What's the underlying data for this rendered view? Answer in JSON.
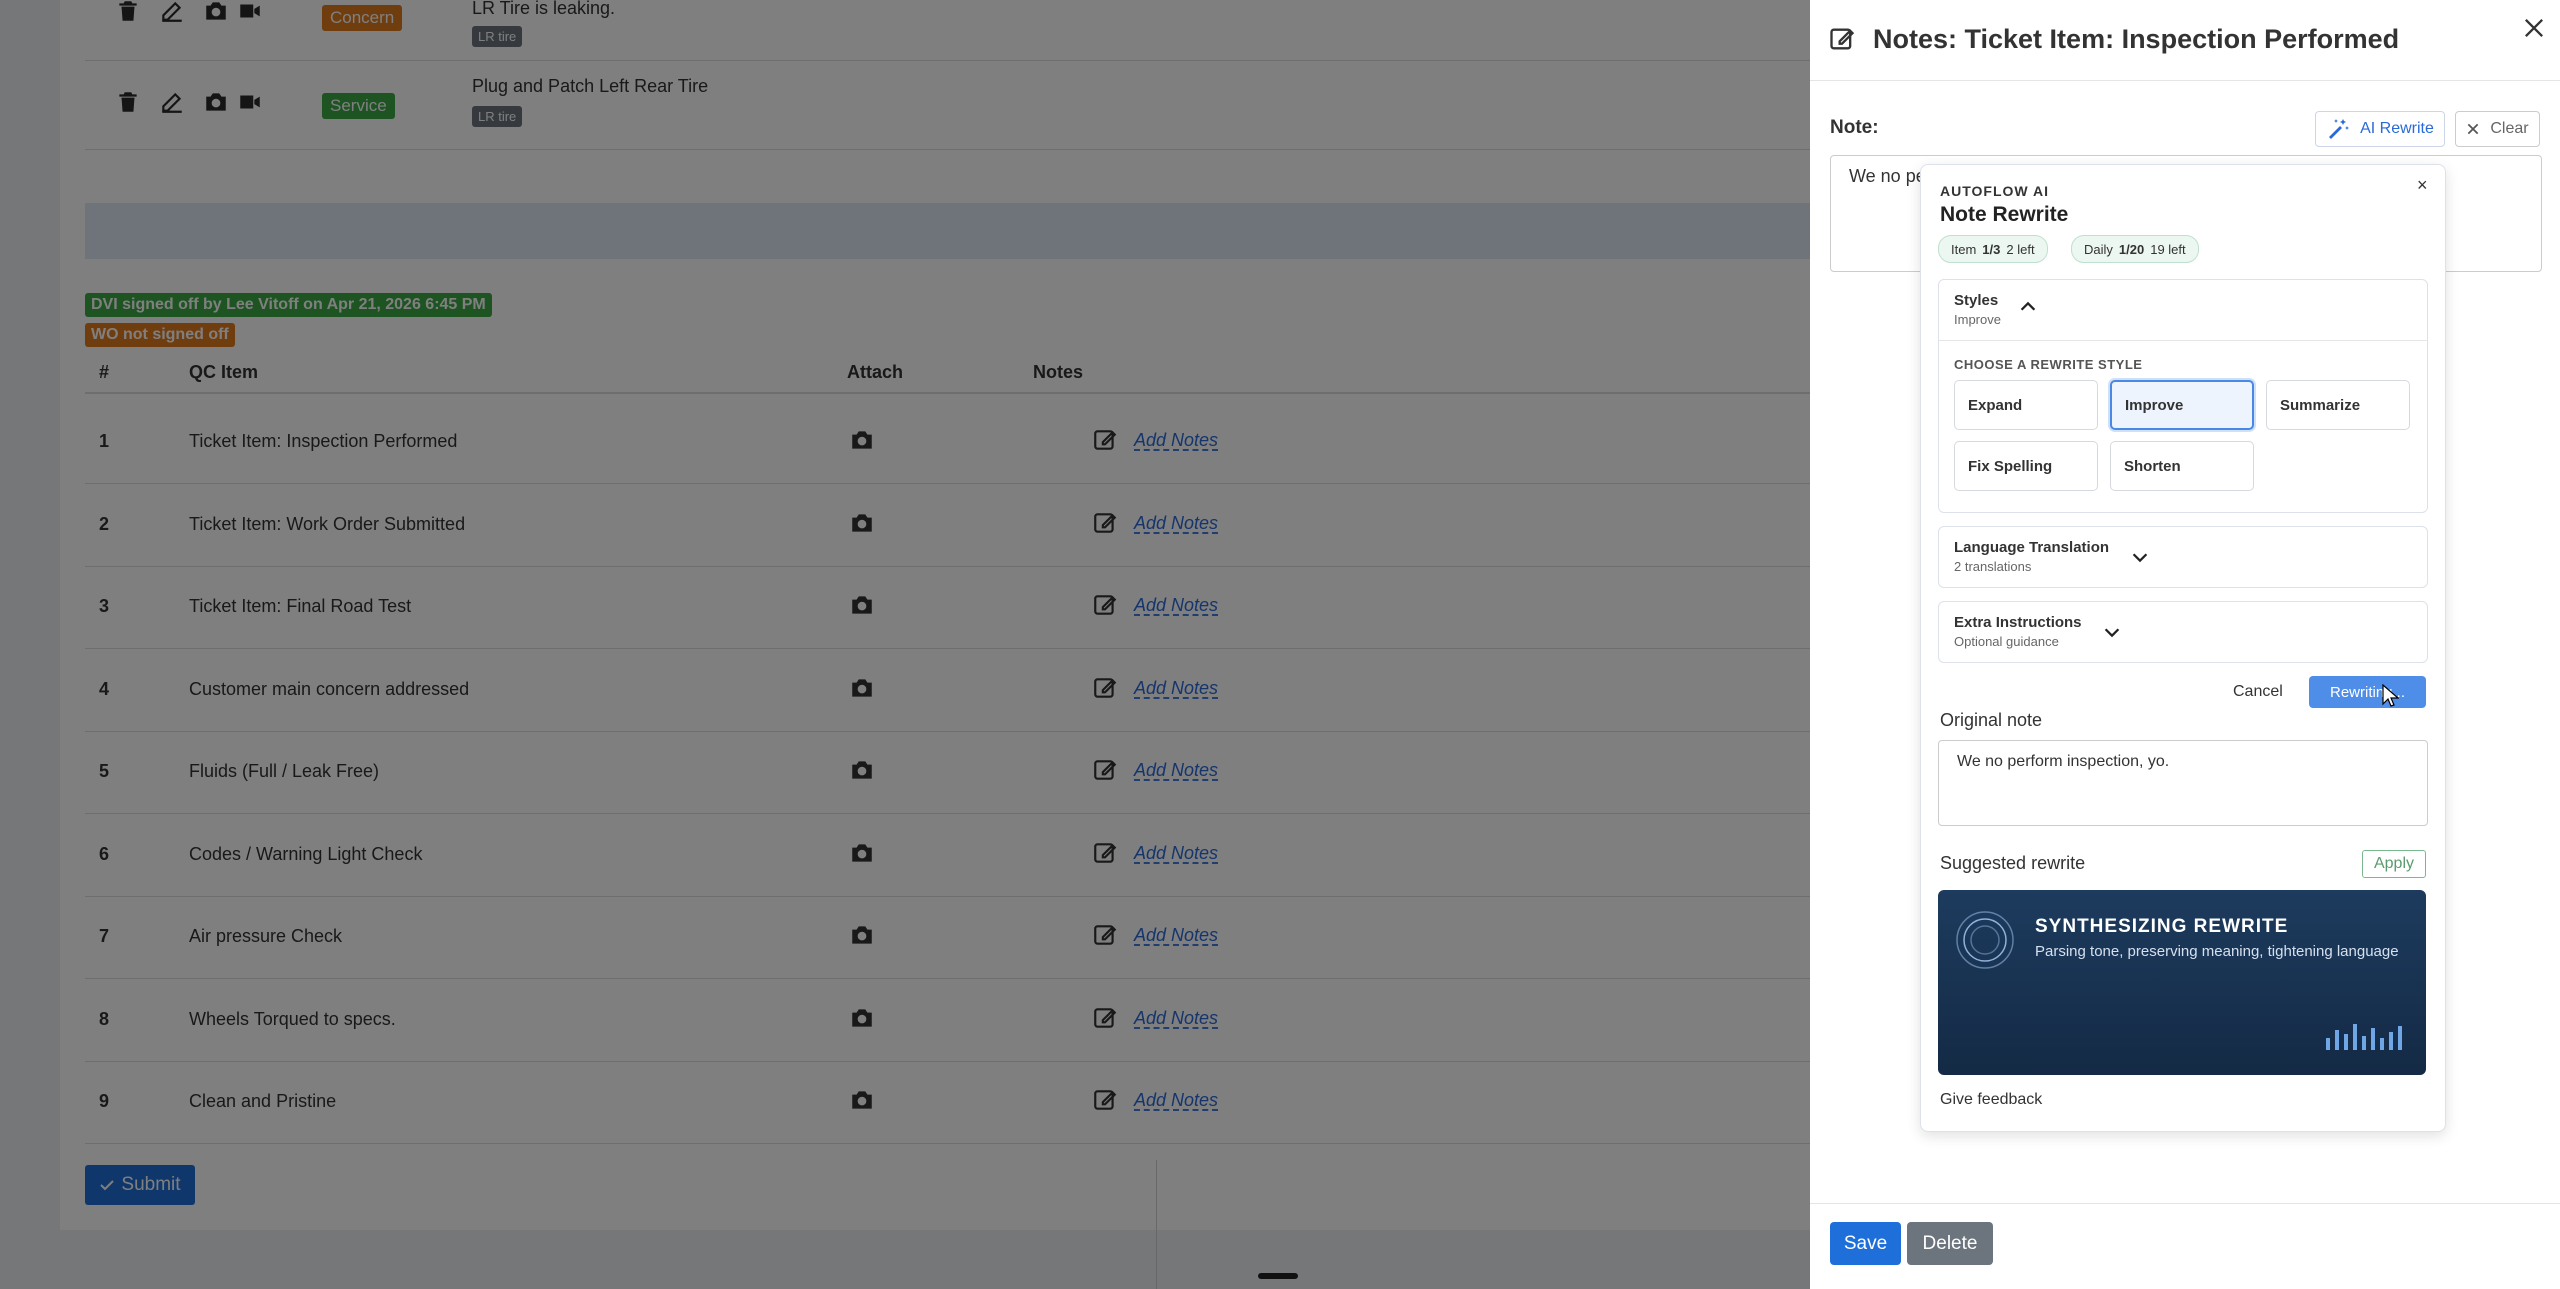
{
  "service_rows": [
    {
      "badge": "Concern",
      "badge_color": "#e07a1f",
      "text": "LR Tire is leaking.",
      "tag": "LR tire"
    },
    {
      "badge": "Service",
      "badge_color": "#3aa845",
      "text": "Plug and Patch Left Rear Tire",
      "tag": "LR tire"
    }
  ],
  "signoff": {
    "dvi": "DVI signed off by Lee Vitoff on Apr 21, 2026 6:45 PM",
    "dvi_color": "#3aa845",
    "wo": "WO not signed off",
    "wo_color": "#e07a1f"
  },
  "qc_table": {
    "headers": {
      "num": "#",
      "item": "QC Item",
      "attach": "Attach",
      "notes": "Notes"
    },
    "rows": [
      {
        "num": "1",
        "item": "Ticket Item: Inspection Performed",
        "notes_link": "Add Notes"
      },
      {
        "num": "2",
        "item": "Ticket Item: Work Order Submitted",
        "notes_link": "Add Notes"
      },
      {
        "num": "3",
        "item": "Ticket Item: Final Road Test",
        "notes_link": "Add Notes"
      },
      {
        "num": "4",
        "item": "Customer main concern addressed",
        "notes_link": "Add Notes"
      },
      {
        "num": "5",
        "item": "Fluids (Full / Leak Free)",
        "notes_link": "Add Notes"
      },
      {
        "num": "6",
        "item": "Codes / Warning Light Check",
        "notes_link": "Add Notes"
      },
      {
        "num": "7",
        "item": "Air pressure Check",
        "notes_link": "Add Notes"
      },
      {
        "num": "8",
        "item": "Wheels Torqued to specs.",
        "notes_link": "Add Notes"
      },
      {
        "num": "9",
        "item": "Clean and Pristine",
        "notes_link": "Add Notes"
      }
    ]
  },
  "submit_label": "Submit",
  "panel": {
    "title": "Notes: Ticket Item: Inspection Performed",
    "note_label": "Note:",
    "ai_rewrite_label": "AI Rewrite",
    "clear_label": "Clear",
    "note_value": "We no pe",
    "save_label": "Save",
    "delete_label": "Delete"
  },
  "ai_popover": {
    "kicker": "AUTOFLOW AI",
    "title": "Note Rewrite",
    "close_glyph": "×",
    "usage": {
      "item_label": "Item",
      "item_count": "1/3",
      "item_left": "2 left",
      "daily_label": "Daily",
      "daily_count": "1/20",
      "daily_left": "19 left"
    },
    "styles": {
      "title": "Styles",
      "subtitle": "Improve",
      "choose_label": "CHOOSE A REWRITE STYLE",
      "options": [
        "Expand",
        "Improve",
        "Summarize",
        "Fix Spelling",
        "Shorten"
      ],
      "selected": "Improve"
    },
    "translation": {
      "title": "Language Translation",
      "subtitle": "2 translations"
    },
    "extra": {
      "title": "Extra Instructions",
      "subtitle": "Optional guidance"
    },
    "cancel_label": "Cancel",
    "rewrite_label": "Rewriting...",
    "original_label": "Original note",
    "original_text": "We no perform inspection, yo.",
    "suggested_label": "Suggested rewrite",
    "apply_label": "Apply",
    "synth_title": "SYNTHESIZING REWRITE",
    "synth_sub": "Parsing tone, preserving meaning, tightening language",
    "feedback_label": "Give feedback"
  },
  "colors": {
    "primary": "#1e6fd9",
    "link": "#2a6ad8",
    "accent_soft": "#4f8ee8"
  },
  "icons": [
    "trash-icon",
    "edit-icon",
    "camera-icon",
    "video-icon",
    "close-icon",
    "magic-wand-icon",
    "chevron-up-icon",
    "chevron-down-icon",
    "check-icon"
  ]
}
